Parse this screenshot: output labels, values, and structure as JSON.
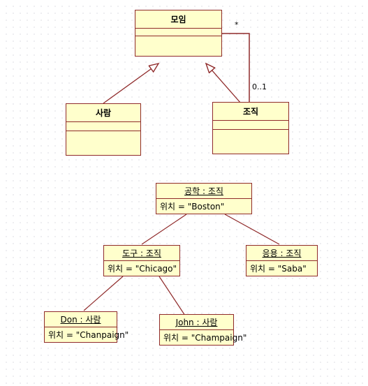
{
  "diagram": {
    "title": "UML class and object diagram",
    "colors": {
      "node_fill": "#ffffcc",
      "node_border": "#8f2a2a",
      "edge": "#8f2a2a",
      "grid_dot": "#b9b9c8",
      "background": "#ffffff"
    }
  },
  "class_diagram": {
    "classes": [
      {
        "id": "meeting",
        "name": "모임"
      },
      {
        "id": "person",
        "name": "사람"
      },
      {
        "id": "organization",
        "name": "조직"
      }
    ],
    "multiplicities": [
      {
        "id": "many",
        "label": "*"
      },
      {
        "id": "zero-or-one",
        "label": "0..1"
      }
    ],
    "relations": [
      {
        "type": "generalization",
        "from": "사람",
        "to": "모임"
      },
      {
        "type": "generalization",
        "from": "조직",
        "to": "모임"
      },
      {
        "type": "association",
        "from": "모임",
        "to": "조직",
        "source_multiplicity": "*",
        "target_multiplicity": "0..1"
      }
    ]
  },
  "object_diagram": {
    "objects": [
      {
        "id": "engineering",
        "name": "공학 : 조직",
        "slot_label": "위치",
        "slot_operator": "=",
        "slot_value": "\"Boston\"",
        "slot_text": "위치 = \"Boston\""
      },
      {
        "id": "tools",
        "name": "도구 : 조직",
        "slot_label": "위치",
        "slot_operator": "=",
        "slot_value": "\"Chicago\"",
        "slot_text": "위치 = \"Chicago\""
      },
      {
        "id": "application",
        "name": "응용 : 조직",
        "slot_label": "위치",
        "slot_operator": "=",
        "slot_value": "\"Saba\"",
        "slot_text": "위치 = \"Saba\""
      },
      {
        "id": "don",
        "name": "Don : 사람",
        "slot_label": "위치",
        "slot_operator": "=",
        "slot_value": "\"Chanpaign\"",
        "slot_text": "위치 = \"Chanpaign\""
      },
      {
        "id": "john",
        "name": "John : 사람",
        "slot_label": "위치",
        "slot_operator": "=",
        "slot_value": "\"Champaign\"",
        "slot_text": "위치 = \"Champaign\""
      }
    ],
    "links": [
      {
        "from": "공학 : 조직",
        "to": "도구 : 조직"
      },
      {
        "from": "공학 : 조직",
        "to": "응용 : 조직"
      },
      {
        "from": "도구 : 조직",
        "to": "Don : 사람"
      },
      {
        "from": "도구 : 조직",
        "to": "John : 사람"
      }
    ]
  }
}
